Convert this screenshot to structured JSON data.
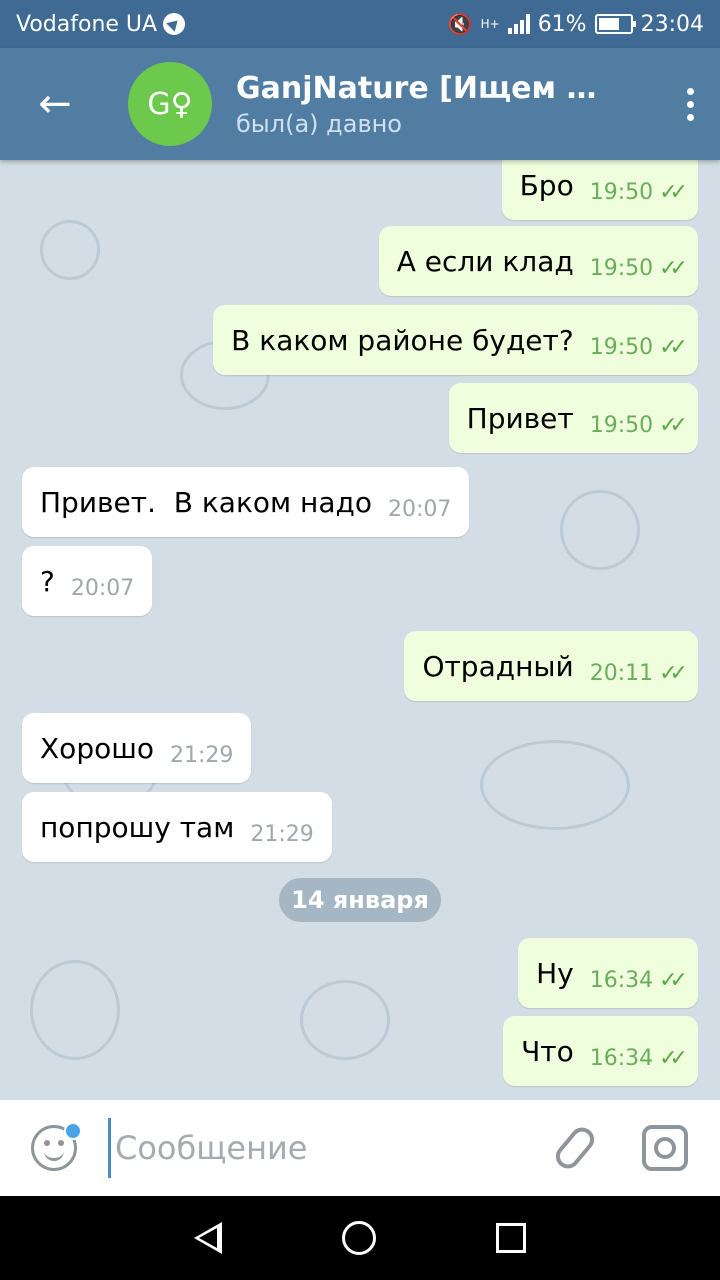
{
  "status_bar": {
    "carrier": "Vodafone UA",
    "network": "H+",
    "battery": "61%",
    "time": "23:04"
  },
  "header": {
    "title": "GanjNature [Ищем ку…",
    "status": "был(а) давно",
    "avatar_initials": "G♀",
    "avatar_color": "#6cc94b"
  },
  "messages": [
    {
      "direction": "out",
      "text": "Бро",
      "time": "19:50",
      "read": true
    },
    {
      "direction": "out",
      "text": "А если клад",
      "time": "19:50",
      "read": true
    },
    {
      "direction": "out",
      "text": "В каком районе будет?",
      "time": "19:50",
      "read": true
    },
    {
      "direction": "out",
      "text": "Привет",
      "time": "19:50",
      "read": true
    },
    {
      "direction": "in",
      "text": "Привет.  В каком надо",
      "time": "20:07"
    },
    {
      "direction": "in",
      "text": "?",
      "time": "20:07"
    },
    {
      "direction": "out",
      "text": "Отрадный",
      "time": "20:11",
      "read": true
    },
    {
      "direction": "in",
      "text": "Хорошо",
      "time": "21:29"
    },
    {
      "direction": "in",
      "text": "попрошу там",
      "time": "21:29"
    },
    {
      "direction": "out",
      "text": "Ну",
      "time": "16:34",
      "read": true
    },
    {
      "direction": "out",
      "text": "Что",
      "time": "16:34",
      "read": true
    }
  ],
  "date_separator": "14 января",
  "input": {
    "placeholder": "Сообщение"
  },
  "colors": {
    "header": "#517da2",
    "statusbar": "#3e6a94",
    "outgoing_bubble": "#effedd",
    "incoming_bubble": "#ffffff",
    "chat_background": "#d3dde5"
  }
}
